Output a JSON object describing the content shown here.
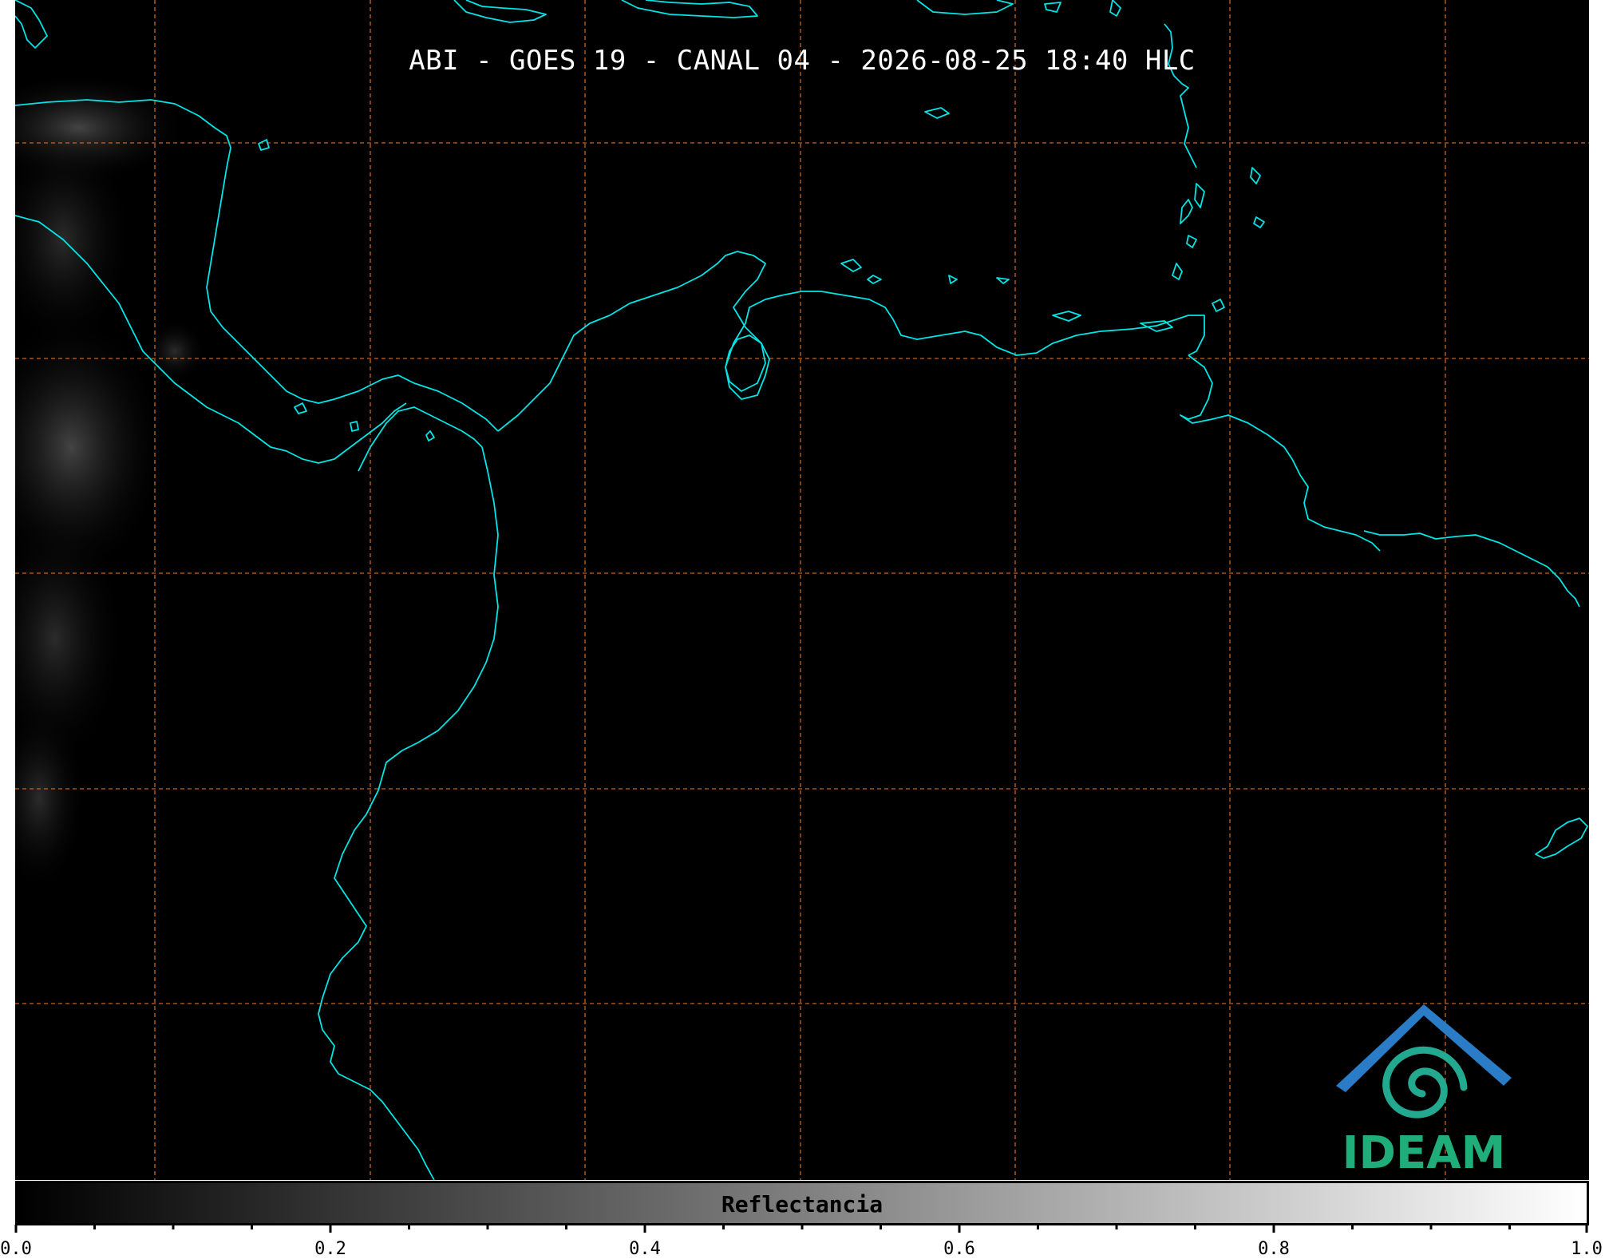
{
  "map": {
    "title": "ABI - GOES 19 - CANAL 04 - 2026-08-25 18:40 HLC",
    "background_color": "#000000",
    "coastline_color": "#00e5e5",
    "grid_color": "#c8651e",
    "grid_style": "dashed"
  },
  "colorbar": {
    "label": "Reflectancia",
    "range": [
      0.0,
      1.0
    ],
    "gradient": [
      "#000000",
      "#ffffff"
    ],
    "tick_labels": [
      "0.0",
      "0.2",
      "0.4",
      "0.6",
      "0.8",
      "1.0"
    ]
  },
  "logo": {
    "text": "IDEAM",
    "roof_color": "#2a7cc7",
    "spiral_color": "#22a98f",
    "text_color": "#1fae7a"
  }
}
